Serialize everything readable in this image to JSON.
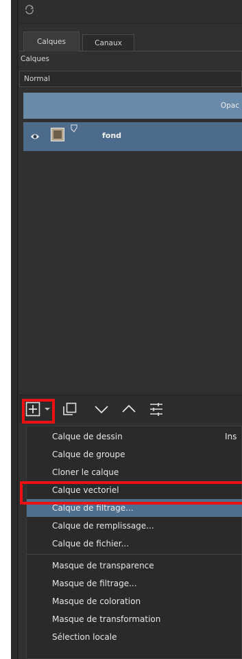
{
  "tabs": [
    {
      "label": "Calques",
      "active": true
    },
    {
      "label": "Canaux",
      "active": false
    }
  ],
  "panel": {
    "section_label": "Calques",
    "blend_mode": "Normal",
    "opacity_label": "Opac"
  },
  "layers": [
    {
      "name": "fond",
      "visible": true,
      "selected": true
    }
  ],
  "toolbar": {
    "icons": [
      "add-layer-icon",
      "dropdown-arrow-icon",
      "duplicate-icon",
      "move-down-icon",
      "move-up-icon",
      "properties-icon"
    ]
  },
  "menu": {
    "items": [
      {
        "label": "Calque de dessin",
        "shortcut": "Ins"
      },
      {
        "label": "Calque de groupe"
      },
      {
        "label": "Cloner le calque"
      },
      {
        "label": "Calque vectoriel"
      },
      {
        "label": "Calque de filtrage...",
        "selected": true
      },
      {
        "label": "Calque de remplissage..."
      },
      {
        "label": "Calque de fichier..."
      },
      {
        "label": "Masque de transparence"
      },
      {
        "label": "Masque de filtrage..."
      },
      {
        "label": "Masque de coloration"
      },
      {
        "label": "Masque de transformation"
      },
      {
        "label": "Sélection locale"
      }
    ]
  },
  "colors": {
    "panel_bg": "#303030",
    "selection": "#4f6f8f",
    "opacity_bar": "#6a8aaa",
    "highlight": "#ee1111"
  }
}
